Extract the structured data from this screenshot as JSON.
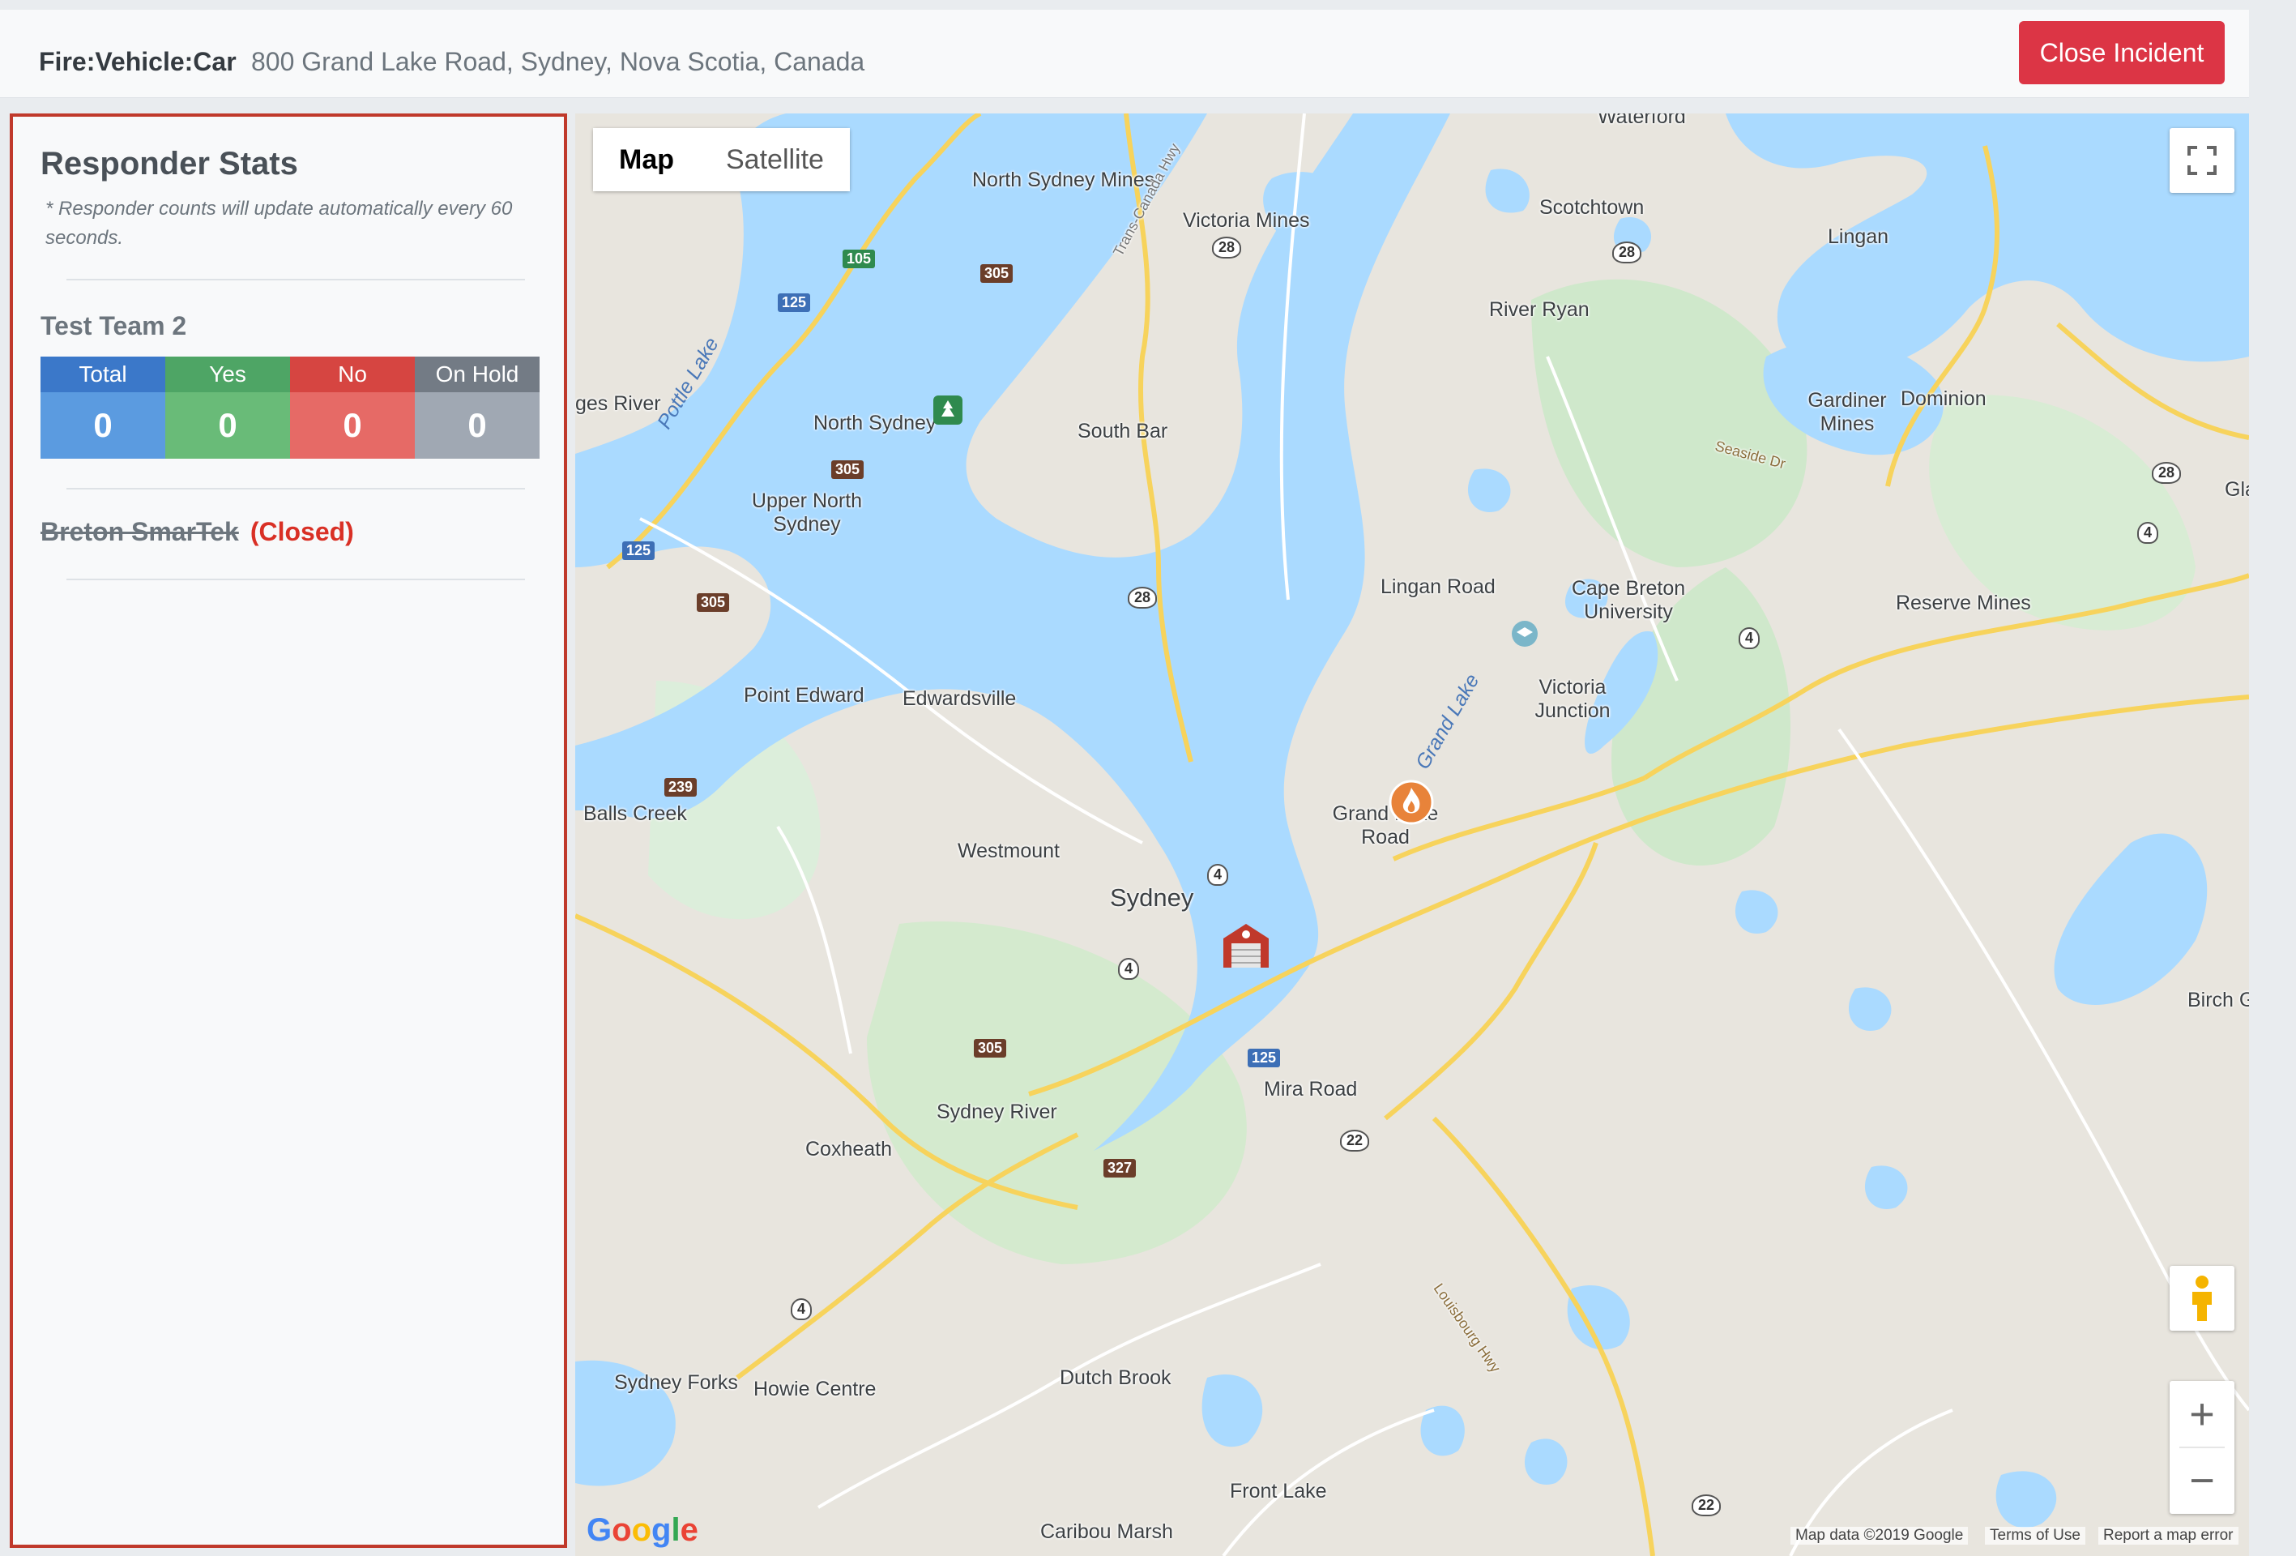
{
  "header": {
    "incident_type": "Fire:Vehicle:Car",
    "address": "800 Grand Lake Road, Sydney, Nova Scotia, Canada",
    "close_label": "Close Incident"
  },
  "panel": {
    "title": "Responder Stats",
    "note": "* Responder counts will update automatically every 60 seconds.",
    "teams": [
      {
        "name": "Test Team 2",
        "stats": [
          {
            "label": "Total",
            "value": "0"
          },
          {
            "label": "Yes",
            "value": "0"
          },
          {
            "label": "No",
            "value": "0"
          },
          {
            "label": "On Hold",
            "value": "0"
          }
        ]
      },
      {
        "name": "Breton SmarTek",
        "status": "(Closed)"
      }
    ]
  },
  "map": {
    "type_buttons": [
      "Map",
      "Satellite"
    ],
    "google_logo": "Google",
    "attribution": [
      "Map data ©2019 Google",
      "Terms of Use",
      "Report a map error"
    ],
    "places": [
      "Waterford",
      "North Sydney Mines",
      "Victoria Mines",
      "Scotchtown",
      "Lingan",
      "River Ryan",
      "Dominion",
      "Gardiner Mines",
      "ges River",
      "North Sydney",
      "South Bar",
      "Upper North Sydney",
      "Lingan Road",
      "Cape Breton University",
      "Reserve Mines",
      "Gla",
      "Point Edward",
      "Edwardsville",
      "Victoria Junction",
      "Balls Creek",
      "Grand Lake Road",
      "Westmount",
      "Sydney",
      "Birch G",
      "Mira Road",
      "Sydney River",
      "Coxheath",
      "Dutch Brook",
      "Sydney Forks",
      "Howie Centre",
      "Front Lake",
      "Caribou Marsh"
    ],
    "water_labels": [
      "Pottle Lake",
      "Grand Lake",
      "Trans-Canada Hwy",
      "Seaside Dr",
      "Louisbourg Hwy"
    ],
    "shields": [
      "125",
      "305",
      "105",
      "28",
      "4",
      "239",
      "327",
      "22"
    ]
  }
}
